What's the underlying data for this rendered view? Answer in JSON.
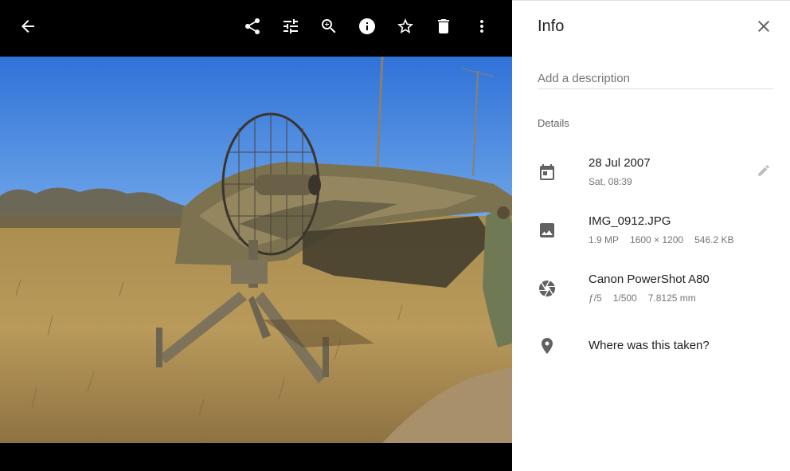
{
  "toolbar": {
    "icons": [
      "back-arrow-icon",
      "share-icon",
      "tune-icon",
      "zoom-in-icon",
      "info-icon",
      "star-icon",
      "delete-icon",
      "more-vert-icon"
    ]
  },
  "info_panel": {
    "title": "Info",
    "description_placeholder": "Add a description",
    "details_label": "Details",
    "date": {
      "primary": "28 Jul 2007",
      "secondary": "Sat, 08:39"
    },
    "file": {
      "name": "IMG_0912.JPG",
      "megapixels": "1.9 MP",
      "resolution": "1600 × 1200",
      "size": "546.2 KB"
    },
    "camera": {
      "model": "Canon PowerShot A80",
      "aperture": "ƒ/5",
      "shutter": "1/500",
      "focal_length": "7.8125 mm"
    },
    "location_link": "Where was this taken?"
  },
  "colors": {
    "accent": "#1a73e8",
    "viewer_bg": "#000000",
    "icon_grey": "#616161"
  }
}
